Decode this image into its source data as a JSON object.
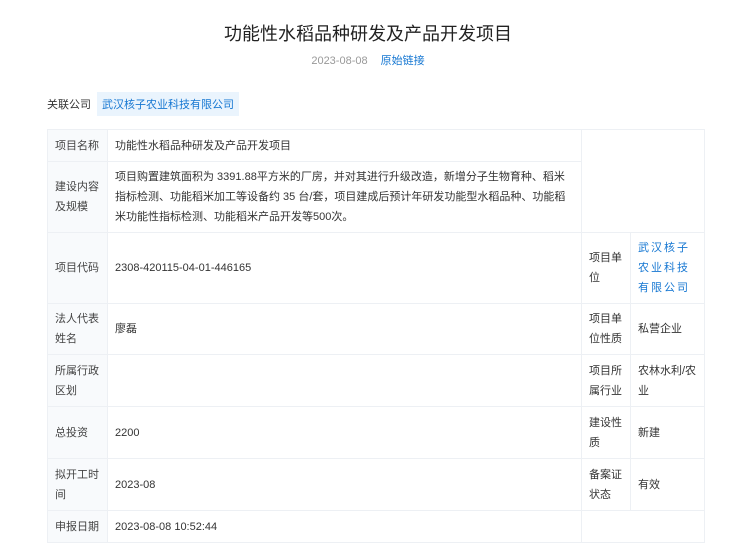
{
  "title": "功能性水稻品种研发及产品开发项目",
  "date": "2023-08-08",
  "source_link": "原始链接",
  "related": {
    "label": "关联公司",
    "company": "武汉核子农业科技有限公司"
  },
  "rows": {
    "name": {
      "label": "项目名称",
      "value": "功能性水稻品种研发及产品开发项目"
    },
    "content": {
      "label": "建设内容及规模",
      "value": "项目购置建筑面积为 3391.88平方米的厂房，并对其进行升级改造，新增分子生物育种、稻米指标检测、功能稻米加工等设备约 35 台/套，项目建成后预计年研发功能型水稻品种、功能稻米功能性指标检测、功能稻米产品开发等500次。"
    },
    "code": {
      "label": "项目代码",
      "value": "2308-420115-04-01-446165",
      "label2": "项目单位",
      "value2": "武汉核子农业科技有限公司"
    },
    "legal": {
      "label": "法人代表姓名",
      "value": "廖磊",
      "label2": "项目单位性质",
      "value2": "私营企业"
    },
    "region": {
      "label": "所属行政区划",
      "value": "",
      "label2": "项目所属行业",
      "value2": "农林水利/农业"
    },
    "invest": {
      "label": "总投资",
      "value": "2200",
      "label2": "建设性质",
      "value2": "新建"
    },
    "start": {
      "label": "拟开工时间",
      "value": "2023-08",
      "label2": "备案证状态",
      "value2": "有效"
    },
    "report": {
      "label": "申报日期",
      "value": "2023-08-08 10:52:44"
    }
  }
}
